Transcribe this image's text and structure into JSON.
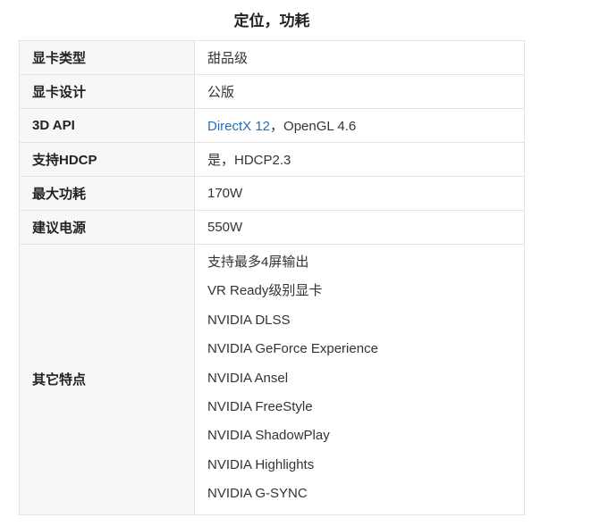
{
  "page": {
    "title": "定位，功耗"
  },
  "rows": [
    {
      "key": "显卡类型",
      "value": "甜品级"
    },
    {
      "key": "显卡设计",
      "value": "公版"
    },
    {
      "key": "3D API",
      "value_link": "DirectX 12",
      "value_rest": "，OpenGL 4.6"
    },
    {
      "key": "支持HDCP",
      "value": "是，HDCP2.3"
    },
    {
      "key": "最大功耗",
      "value": "170W"
    },
    {
      "key": "建议电源",
      "value": "550W"
    }
  ],
  "features": {
    "key": "其它特点",
    "items": [
      "支持最多4屏输出",
      "VR Ready级别显卡",
      "NVIDIA DLSS",
      "NVIDIA GeForce Experience",
      "NVIDIA Ansel",
      "NVIDIA FreeStyle",
      "NVIDIA ShadowPlay",
      "NVIDIA Highlights",
      "NVIDIA G-SYNC"
    ]
  },
  "colors": {
    "link": "#1f6fbf",
    "key_background": "#f7f7f7",
    "border": "#e3e3e3"
  }
}
